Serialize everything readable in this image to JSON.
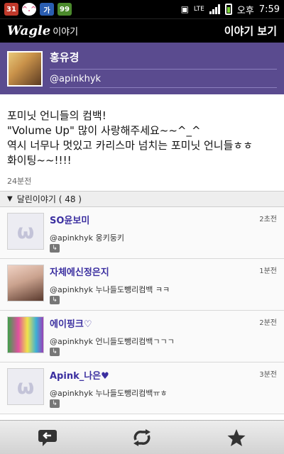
{
  "status": {
    "icons": [
      "calendar-icon",
      "cat-icon",
      "keyboard-icon",
      "battery-status-icon"
    ],
    "calendar_day": "31",
    "notify_keyboard": "가",
    "notify_other": "99",
    "network": "LTE",
    "ampm": "오후",
    "time": "7:59"
  },
  "appbar": {
    "logo": "Wagle",
    "logo_sub": "이야기",
    "title": "이야기 보기"
  },
  "profile": {
    "name": "홍유경",
    "handle": "@apinkhyk"
  },
  "tweet": {
    "lines": [
      "포미닛 언니들의 컴백!",
      "\"Volume Up\" 많이 사랑해주세요~~^_^",
      "역시 너무나 멋있고 카리스마 넘치는 포미닛 언니들ㅎㅎ",
      "화이팅~~!!!!"
    ],
    "time": "24분전"
  },
  "replies": {
    "header": "달린이야기 ( 48 )",
    "items": [
      {
        "name": "SO윤보미",
        "text": "@apinkhyk 웅키둥키",
        "time": "2초전",
        "thumb": "default"
      },
      {
        "name": "자체에신정은지",
        "text": "@apinkhyk 누나들도뺑리컴백 ㅋㅋ",
        "time": "1분전",
        "thumb": "photo1"
      },
      {
        "name": "에이핑크♡",
        "text": "@apinkhyk 언니들도뺑리컴백ㄱㄱㄱ",
        "time": "2분전",
        "thumb": "photo2"
      },
      {
        "name": "Apink_나은♥",
        "text": "@apinkhyk 누나들도뺑리컴백ㅠㅎ",
        "time": "3분전",
        "thumb": "default"
      }
    ]
  },
  "bottombar": {
    "buttons": [
      "reply-icon",
      "retweet-icon",
      "favorite-star-icon"
    ]
  },
  "colors": {
    "profile_bg": "#5a4b8f",
    "name_color": "#3b2fa0"
  }
}
